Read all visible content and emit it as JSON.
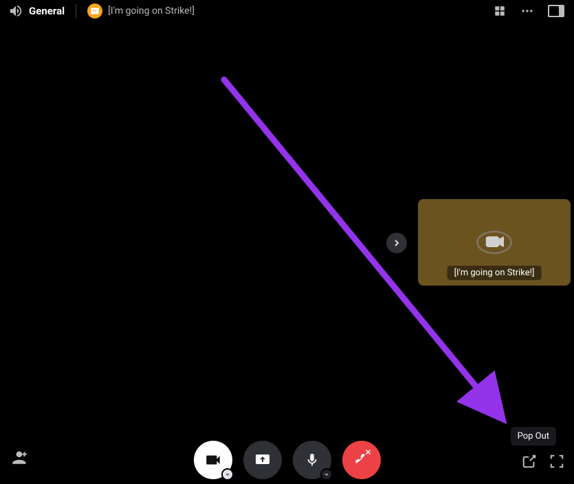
{
  "header": {
    "channel_name": "General",
    "user_name": "[I'm going on Strike!]"
  },
  "participant": {
    "label": "[I'm going on Strike!]"
  },
  "tooltip": {
    "pop_out": "Pop Out"
  }
}
